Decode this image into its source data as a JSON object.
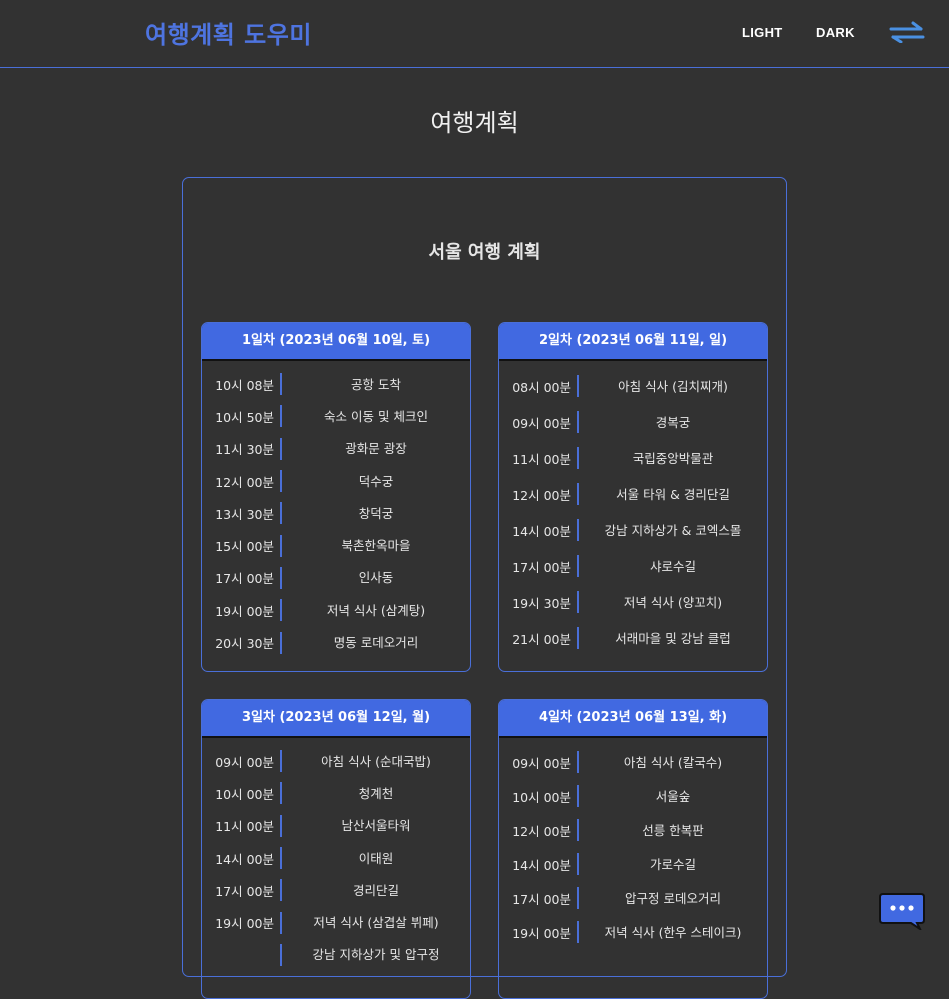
{
  "header": {
    "logo": "여행계획 도우미",
    "light_label": "LIGHT",
    "dark_label": "DARK",
    "menu_icon": "double-arrow-icon"
  },
  "page_title": "여행계획",
  "plan": {
    "title": "서울 여행 계획",
    "days": [
      {
        "title": "1일차 (2023년 06월 10일, 토)",
        "items": [
          {
            "time": "10시 08분",
            "place": "공항 도착"
          },
          {
            "time": "10시 50분",
            "place": "숙소 이동 및 체크인"
          },
          {
            "time": "11시 30분",
            "place": "광화문 광장"
          },
          {
            "time": "12시 00분",
            "place": "덕수궁"
          },
          {
            "time": "13시 30분",
            "place": "창덕궁"
          },
          {
            "time": "15시 00분",
            "place": "북촌한옥마을"
          },
          {
            "time": "17시 00분",
            "place": "인사동"
          },
          {
            "time": "19시 00분",
            "place": "저녁 식사 (삼계탕)"
          },
          {
            "time": "20시 30분",
            "place": "명동 로데오거리"
          }
        ]
      },
      {
        "title": "2일차 (2023년 06월 11일, 일)",
        "items": [
          {
            "time": "08시 00분",
            "place": "아침 식사 (김치찌개)"
          },
          {
            "time": "09시 00분",
            "place": "경복궁"
          },
          {
            "time": "11시 00분",
            "place": "국립중앙박물관"
          },
          {
            "time": "12시 00분",
            "place": "서울 타워 & 경리단길"
          },
          {
            "time": "14시 00분",
            "place": "강남 지하상가 & 코엑스몰"
          },
          {
            "time": "17시 00분",
            "place": "샤로수길"
          },
          {
            "time": "19시 30분",
            "place": "저녁 식사 (양꼬치)"
          },
          {
            "time": "21시 00분",
            "place": "서래마을 및 강남 클럽"
          }
        ]
      },
      {
        "title": "3일차 (2023년 06월 12일, 월)",
        "items": [
          {
            "time": "09시 00분",
            "place": "아침 식사 (순대국밥)"
          },
          {
            "time": "10시 00분",
            "place": "청계천"
          },
          {
            "time": "11시 00분",
            "place": "남산서울타워"
          },
          {
            "time": "14시 00분",
            "place": "이태원"
          },
          {
            "time": "17시 00분",
            "place": "경리단길"
          },
          {
            "time": "19시 00분",
            "place": "저녁 식사 (삼겹살 뷔페)"
          },
          {
            "time": "",
            "place": "강남 지하상가 및 압구정"
          }
        ]
      },
      {
        "title": "4일차 (2023년 06월 13일, 화)",
        "items": [
          {
            "time": "09시 00분",
            "place": "아침 식사 (칼국수)"
          },
          {
            "time": "10시 00분",
            "place": "서울숲"
          },
          {
            "time": "12시 00분",
            "place": "선릉 한복판"
          },
          {
            "time": "14시 00분",
            "place": "가로수길"
          },
          {
            "time": "17시 00분",
            "place": "압구정 로데오거리"
          },
          {
            "time": "19시 00분",
            "place": "저녁 식사 (한우 스테이크)"
          }
        ]
      }
    ]
  },
  "chat_icon": "chat-bubble-icon",
  "colors": {
    "accent": "#4169e1",
    "background": "#323232",
    "logo": "#4e74e0"
  }
}
